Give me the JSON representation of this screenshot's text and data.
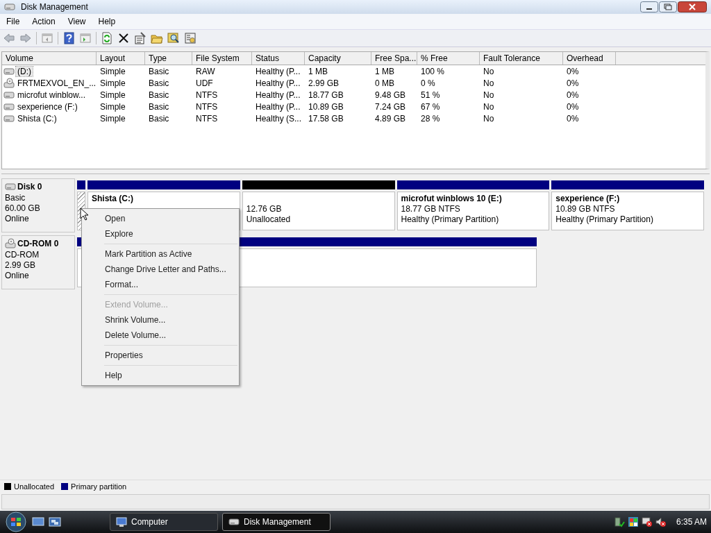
{
  "window": {
    "title": "Disk Management"
  },
  "menu_bar": [
    "File",
    "Action",
    "View",
    "Help"
  ],
  "volume_list": {
    "columns": [
      "Volume",
      "Layout",
      "Type",
      "File System",
      "Status",
      "Capacity",
      "Free Spa...",
      "% Free",
      "Fault Tolerance",
      "Overhead"
    ],
    "rows": [
      {
        "kind": "disk",
        "selected": true,
        "cells": [
          "(D:)",
          "Simple",
          "Basic",
          "RAW",
          "Healthy (P...",
          "1 MB",
          "1 MB",
          "100 %",
          "No",
          "0%"
        ]
      },
      {
        "kind": "cdrom",
        "selected": false,
        "cells": [
          "FRTMEXVOL_EN_...",
          "Simple",
          "Basic",
          "UDF",
          "Healthy (P...",
          "2.99 GB",
          "0 MB",
          "0 %",
          "No",
          "0%"
        ]
      },
      {
        "kind": "disk",
        "selected": false,
        "cells": [
          "microfut winblow...",
          "Simple",
          "Basic",
          "NTFS",
          "Healthy (P...",
          "18.77 GB",
          "9.48 GB",
          "51 %",
          "No",
          "0%"
        ]
      },
      {
        "kind": "disk",
        "selected": false,
        "cells": [
          "sexperience (F:)",
          "Simple",
          "Basic",
          "NTFS",
          "Healthy (P...",
          "10.89 GB",
          "7.24 GB",
          "67 %",
          "No",
          "0%"
        ]
      },
      {
        "kind": "disk",
        "selected": false,
        "cells": [
          "Shista (C:)",
          "Simple",
          "Basic",
          "NTFS",
          "Healthy (S...",
          "17.58 GB",
          "4.89 GB",
          "28 %",
          "No",
          "0%"
        ]
      }
    ]
  },
  "disks": [
    {
      "kind": "disk",
      "name": "Disk 0",
      "type": "Basic",
      "size": "60.00 GB",
      "status": "Online",
      "partitions": [
        {
          "kind": "raw"
        },
        {
          "kind": "primary",
          "name": "Shista (C:)"
        },
        {
          "kind": "unallocated",
          "size": "12.76 GB",
          "status": "Unallocated"
        },
        {
          "kind": "primary",
          "name": "microfut winblows 10 (E:)",
          "size": "18.77 GB NTFS",
          "status": "Healthy (Primary Partition)"
        },
        {
          "kind": "primary",
          "name": "sexperience (F:)",
          "size": "10.89 GB NTFS",
          "status": "Healthy (Primary Partition)"
        }
      ]
    },
    {
      "kind": "cdrom",
      "name": "CD-ROM 0",
      "type": "CD-ROM",
      "size": "2.99 GB",
      "status": "Online",
      "partitions": [
        {
          "kind": "primary"
        }
      ]
    }
  ],
  "context_menu": [
    {
      "label": "Open",
      "disabled": false
    },
    {
      "label": "Explore",
      "disabled": false,
      "separator_after": true
    },
    {
      "label": "Mark Partition as Active",
      "disabled": false
    },
    {
      "label": "Change Drive Letter and Paths...",
      "disabled": false
    },
    {
      "label": "Format...",
      "disabled": false,
      "separator_after": true
    },
    {
      "label": "Extend Volume...",
      "disabled": true
    },
    {
      "label": "Shrink Volume...",
      "disabled": false
    },
    {
      "label": "Delete Volume...",
      "disabled": false,
      "separator_after": true
    },
    {
      "label": "Properties",
      "disabled": false,
      "separator_after": true
    },
    {
      "label": "Help",
      "disabled": false
    }
  ],
  "legend": [
    {
      "label": "Unallocated",
      "color": "#000000"
    },
    {
      "label": "Primary partition",
      "color": "#000080"
    }
  ],
  "taskbar": {
    "tasks": [
      {
        "label": "Computer",
        "selected": false
      },
      {
        "label": "Disk Management",
        "selected": true
      }
    ],
    "clock": "6:35 AM"
  }
}
